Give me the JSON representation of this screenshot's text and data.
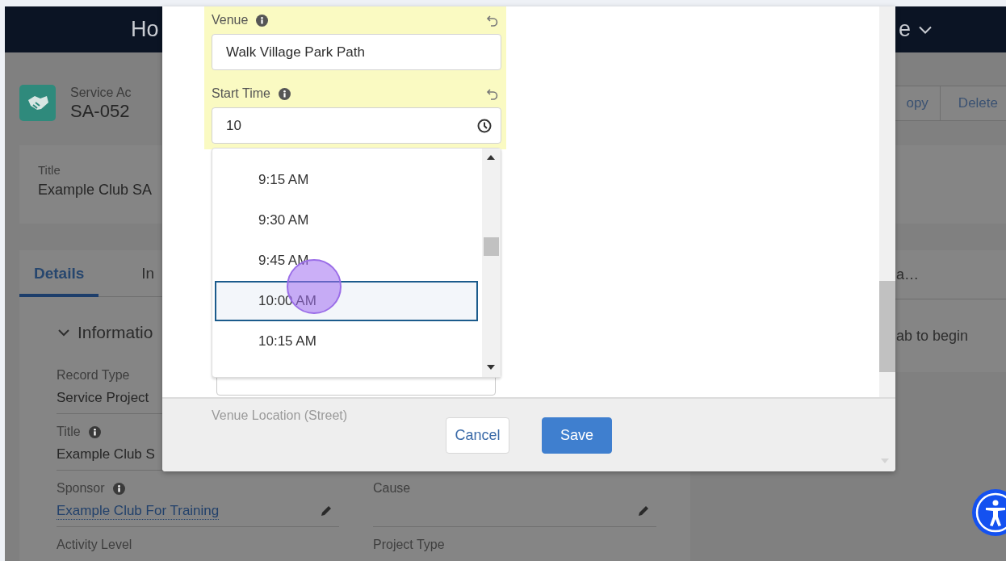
{
  "header": {
    "title_start": "Ho",
    "menu_end": "e"
  },
  "record": {
    "object_type": "Service Ac",
    "name": "SA-052",
    "actions": [
      "opy",
      "Delete"
    ]
  },
  "highlights": [
    {
      "label": "Title",
      "value": "Example Club SA"
    }
  ],
  "tabs": [
    {
      "label": "Details",
      "selected": true
    },
    {
      "label": "In",
      "selected": false
    }
  ],
  "section": {
    "title": "Informatio",
    "expanded": true
  },
  "field_rows": [
    {
      "cells": [
        {
          "label": "Record Type",
          "value": "Service Project",
          "kind": "text"
        }
      ]
    },
    {
      "cells": [
        {
          "label": "Title",
          "value": "Example Club S",
          "kind": "text",
          "info": true
        }
      ]
    },
    {
      "cells": [
        {
          "label": "Sponsor",
          "value": "Example Club For Training",
          "kind": "link",
          "info": true,
          "editable": true
        },
        {
          "label": "Cause",
          "editable": true
        }
      ]
    },
    {
      "cells": [
        {
          "label": "Activity Level"
        },
        {
          "label": "Project Type"
        }
      ]
    }
  ],
  "side_panel": {
    "tab": "a…",
    "message": "ab to begin"
  },
  "modal": {
    "fields": [
      {
        "label": "Venue",
        "value": "Walk Village Park Path",
        "kind": "text",
        "info": true,
        "changed": true
      },
      {
        "label": "Start Time",
        "value": "10",
        "kind": "time",
        "info": true,
        "changed": true
      }
    ],
    "time_options": [
      {
        "label": "9:15 AM",
        "selected": false
      },
      {
        "label": "9:30 AM",
        "selected": false
      },
      {
        "label": "9:45 AM",
        "selected": false
      },
      {
        "label": "10:00 AM",
        "selected": true
      },
      {
        "label": "10:15 AM",
        "selected": false
      }
    ],
    "faded_label": "Venue Location (Street)",
    "buttons": [
      {
        "label": "Cancel",
        "kind": "neutral"
      },
      {
        "label": "Save",
        "kind": "brand"
      }
    ]
  }
}
